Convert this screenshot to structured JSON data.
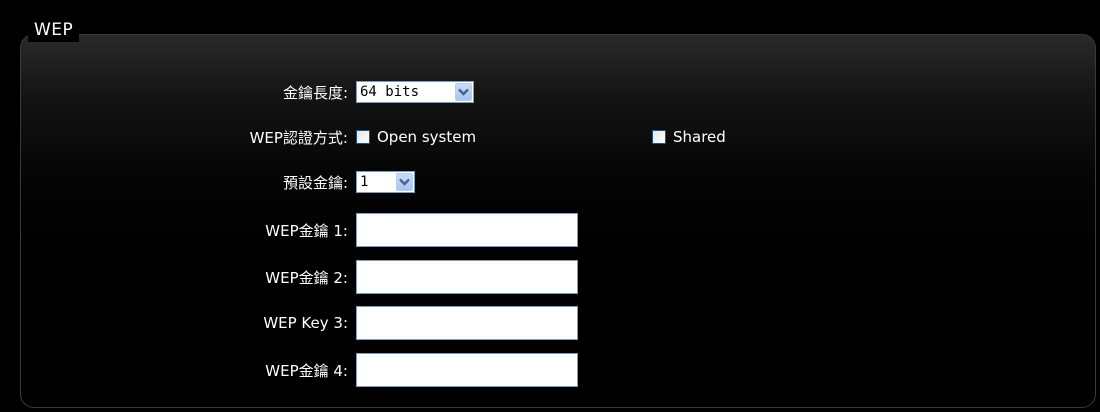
{
  "section": {
    "title": "WEP"
  },
  "key_length": {
    "label": "金鑰長度:",
    "value": "64 bits"
  },
  "auth_method": {
    "label": "WEP認證方式:",
    "options": [
      {
        "label": "Open system",
        "checked": false
      },
      {
        "label": "Shared",
        "checked": false
      }
    ]
  },
  "default_key": {
    "label": "預設金鑰:",
    "value": "1"
  },
  "keys": [
    {
      "label": "WEP金鑰 1:",
      "value": ""
    },
    {
      "label": "WEP金鑰 2:",
      "value": ""
    },
    {
      "label": "WEP Key 3:",
      "value": ""
    },
    {
      "label": "WEP金鑰 4:",
      "value": ""
    }
  ],
  "icons": {
    "dropdown": "chevron-down-icon"
  },
  "colors": {
    "background": "#000000",
    "input_border": "#7f9db9",
    "dropdown_button": "#b7d0f4",
    "checkbox_border": "#1c5180"
  }
}
